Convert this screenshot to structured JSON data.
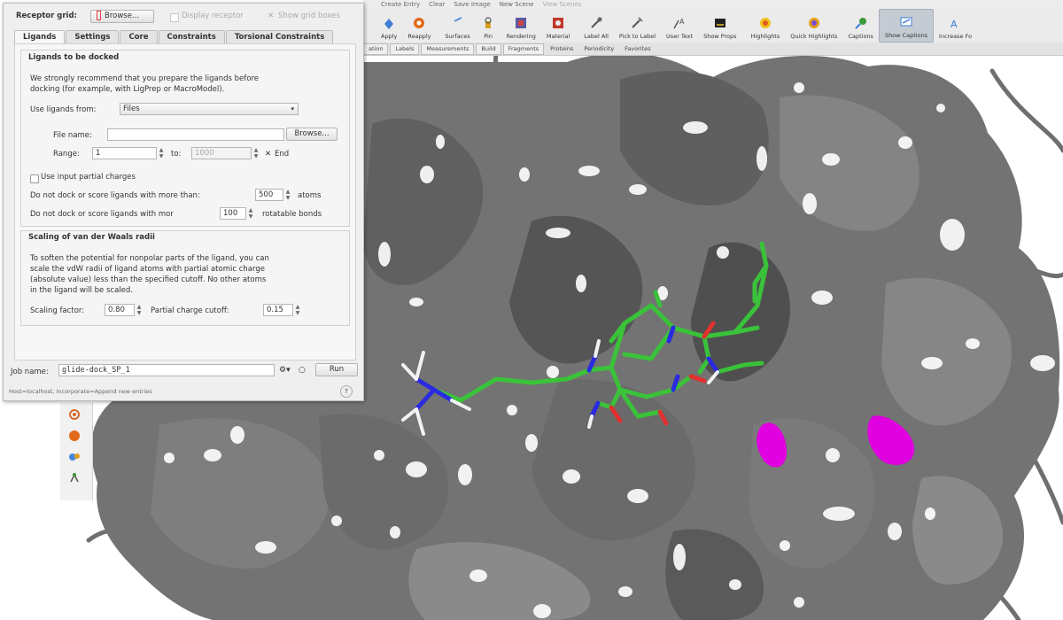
{
  "dialog": {
    "receptor_label": "Receptor grid:",
    "browse_receptor_label": "Browse...",
    "display_receptor_label": "Display receptor",
    "show_grid_boxes_label": "Show grid boxes",
    "tabs": [
      {
        "label": "Ligands"
      },
      {
        "label": "Settings"
      },
      {
        "label": "Core"
      },
      {
        "label": "Constraints"
      },
      {
        "label": "Torsional Constraints"
      }
    ],
    "ligands_group_title": "Ligands to be docked",
    "recommend_text": [
      "We strongly recommend that you prepare the ligands before",
      "docking (for example, with LigPrep or MacroModel)."
    ],
    "use_ligands_label": "Use ligands from:",
    "use_ligands_value": "Files",
    "file_name_label": "File name:",
    "file_name_value": "",
    "browse_file_label": "Browse...",
    "range_label": "Range:",
    "range_from": "1",
    "range_to_label": "to:",
    "range_to": "1000",
    "end_label": "End",
    "partial_charges_label": "Use input partial charges",
    "max_atoms_label": "Do not dock or score ligands with more than:",
    "max_atoms_value": "500",
    "atoms_unit": "atoms",
    "max_rot_label": "Do not dock or score ligands with mor",
    "max_rot_value": "100",
    "rot_unit": "rotatable bonds",
    "vdw_group_title": "Scaling of van der Waals radii",
    "vdw_text": [
      "To soften the potential for nonpolar parts of the ligand, you can",
      "scale the vdW radii of ligand atoms with partial atomic charge",
      "(absolute value) less than the specified cutoff. No other atoms",
      "in the ligand will be scaled."
    ],
    "scaling_label": "Scaling factor:",
    "scaling_value": "0.80",
    "cutoff_label": "Partial charge cutoff:",
    "cutoff_value": "0.15",
    "job_name_label": "Job name:",
    "job_name_value": "glide-dock_SP_1",
    "run_label": "Run",
    "status_text": "Host=localhost, Incorporate=Append new entries",
    "help_label": "?"
  },
  "menu": [
    "Create Entry",
    "Clear",
    "Save Image",
    "New Scene",
    "View Scenes"
  ],
  "toolbar": [
    {
      "label": "Apply",
      "icon": "apply-icon",
      "color": "#3d7fd6"
    },
    {
      "label": "Reapply",
      "icon": "reapply-icon",
      "color": "#e06a1b"
    },
    {
      "label": "Surfaces",
      "icon": "surfaces-icon",
      "color": "#5b8fd6"
    },
    {
      "label": "Pin",
      "icon": "pin-icon",
      "color": "#d8a020"
    },
    {
      "label": "Rendering",
      "icon": "rendering-icon",
      "color": "#5a5aa0"
    },
    {
      "label": "Material",
      "icon": "material-icon",
      "color": "#c0392b"
    },
    {
      "label": "Label All",
      "icon": "label-all-icon",
      "color": "#555555"
    },
    {
      "label": "Pick to Label",
      "icon": "pick-label-icon",
      "color": "#555555"
    },
    {
      "label": "User Text",
      "icon": "user-text-icon",
      "color": "#555555"
    },
    {
      "label": "Show Props",
      "icon": "show-props-icon",
      "color": "#222222"
    },
    {
      "label": "Highlights",
      "icon": "highlights-icon",
      "color": "#e05a1b"
    },
    {
      "label": "Quick Highlights",
      "icon": "quick-highlights-icon",
      "color": "#e0a01b"
    },
    {
      "label": "Captions",
      "icon": "captions-icon",
      "color": "#3a9a3a"
    },
    {
      "label": "Show Captions",
      "icon": "show-captions-icon",
      "color": "#3d7fd6",
      "active": true
    },
    {
      "label": "Increase Fo",
      "icon": "increase-font-icon",
      "color": "#3d7fd6"
    }
  ],
  "subtabs": [
    "ation",
    "Labels",
    "Measurements",
    "Build",
    "Fragments",
    "Proteins",
    "Periodicity",
    "Favorites"
  ]
}
